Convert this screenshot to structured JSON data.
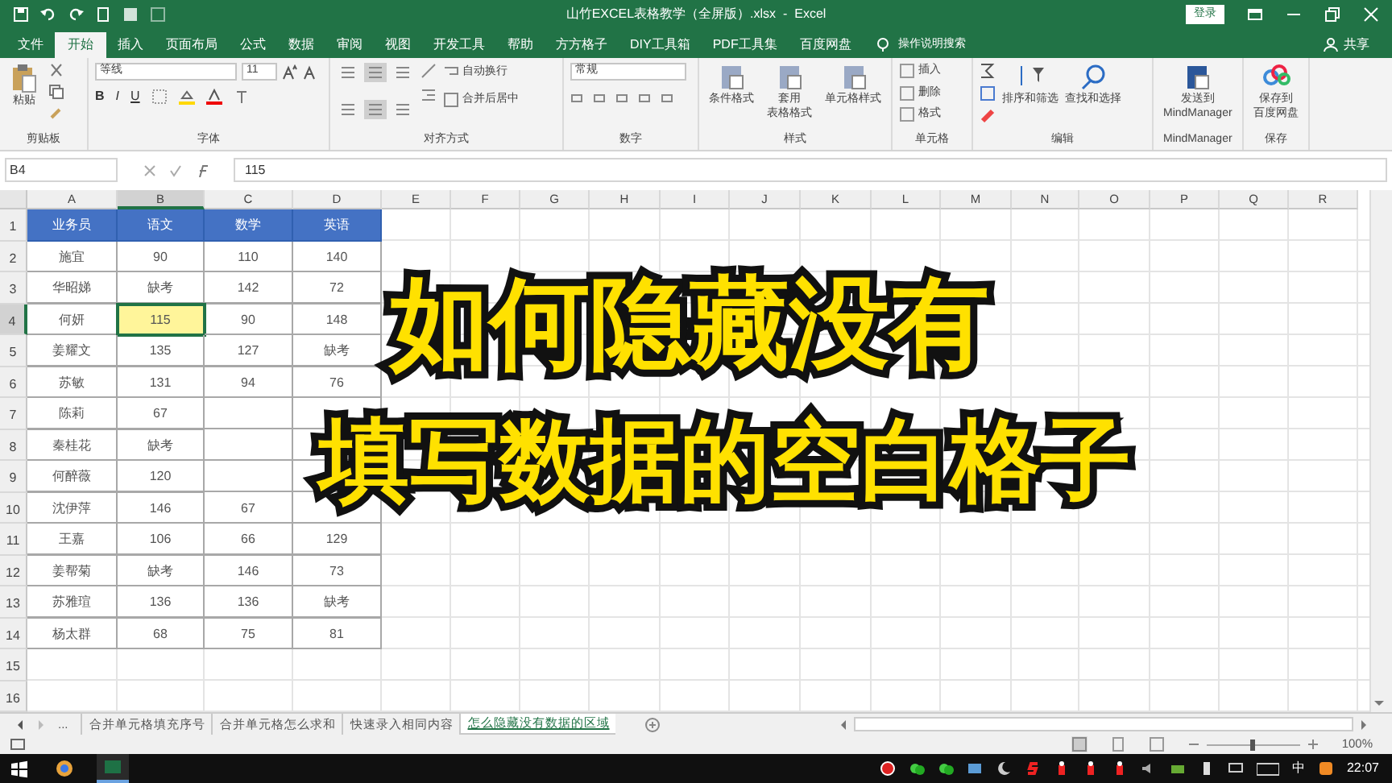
{
  "title_bar": {
    "title": "山竹EXCEL表格教学（全屏版）.xlsx  -  Excel",
    "login": "登录"
  },
  "menu_tabs": [
    {
      "label": "文件",
      "selected": false
    },
    {
      "label": "开始",
      "selected": true
    },
    {
      "label": "插入",
      "selected": false
    },
    {
      "label": "页面布局",
      "selected": false
    },
    {
      "label": "公式",
      "selected": false
    },
    {
      "label": "数据",
      "selected": false
    },
    {
      "label": "审阅",
      "selected": false
    },
    {
      "label": "视图",
      "selected": false
    },
    {
      "label": "开发工具",
      "selected": false
    },
    {
      "label": "帮助",
      "selected": false
    },
    {
      "label": "方方格子",
      "selected": false
    },
    {
      "label": "DIY工具箱",
      "selected": false
    },
    {
      "label": "PDF工具集",
      "selected": false
    },
    {
      "label": "百度网盘",
      "selected": false
    }
  ],
  "tell_me": "操作说明搜索",
  "share": "共享",
  "ribbon": {
    "groups": [
      {
        "kind": "clipboard",
        "label": "剪贴板",
        "buttons": [
          "粘贴"
        ]
      },
      {
        "kind": "font",
        "label": "字体",
        "font": "等线",
        "size": "11",
        "buttons": [
          "B",
          "I",
          "U"
        ]
      },
      {
        "kind": "alignment",
        "label": "对齐方式",
        "buttons": [
          "自动换行",
          "合并后居中"
        ]
      },
      {
        "kind": "number",
        "label": "数字",
        "format": "常规"
      },
      {
        "kind": "large",
        "label": "样式",
        "buttons": [
          [
            "条件格式"
          ],
          [
            "套用",
            "表格格式"
          ],
          [
            "单元格样式"
          ]
        ]
      },
      {
        "kind": "cells",
        "label": "单元格",
        "buttons": [
          "插入",
          "删除",
          "格式"
        ]
      },
      {
        "kind": "editing",
        "label": "编辑",
        "buttons": [
          "排序和筛选",
          "查找和选择"
        ]
      },
      {
        "kind": "large",
        "label": "MindManager",
        "buttons": [
          [
            "发送到",
            "MindManager"
          ]
        ]
      },
      {
        "kind": "large",
        "label": "保存",
        "buttons": [
          [
            "保存到",
            "百度网盘"
          ]
        ]
      }
    ]
  },
  "name_box": "B4",
  "formula": "115",
  "columns": [
    {
      "label": "A",
      "selected": false
    },
    {
      "label": "B",
      "selected": true
    },
    {
      "label": "C",
      "selected": false
    },
    {
      "label": "D",
      "selected": false
    },
    {
      "label": "E",
      "selected": false
    },
    {
      "label": "F",
      "selected": false
    },
    {
      "label": "G",
      "selected": false
    },
    {
      "label": "H",
      "selected": false
    },
    {
      "label": "I",
      "selected": false
    },
    {
      "label": "J",
      "selected": false
    },
    {
      "label": "K",
      "selected": false
    },
    {
      "label": "L",
      "selected": false
    },
    {
      "label": "M",
      "selected": false
    },
    {
      "label": "N",
      "selected": false
    },
    {
      "label": "O",
      "selected": false
    },
    {
      "label": "P",
      "selected": false
    },
    {
      "label": "Q",
      "selected": false
    },
    {
      "label": "R",
      "selected": false
    }
  ],
  "row_headers": [
    {
      "label": "1",
      "selected": false
    },
    {
      "label": "2",
      "selected": false
    },
    {
      "label": "3",
      "selected": false
    },
    {
      "label": "4",
      "selected": true
    },
    {
      "label": "5",
      "selected": false
    },
    {
      "label": "6",
      "selected": false
    },
    {
      "label": "7",
      "selected": false
    },
    {
      "label": "8",
      "selected": false
    },
    {
      "label": "9",
      "selected": false
    },
    {
      "label": "10",
      "selected": false
    },
    {
      "label": "11",
      "selected": false
    },
    {
      "label": "12",
      "selected": false
    },
    {
      "label": "13",
      "selected": false
    },
    {
      "label": "14",
      "selected": false
    },
    {
      "label": "15",
      "selected": false
    },
    {
      "label": "16",
      "selected": false
    }
  ],
  "table": {
    "header": [
      "业务员",
      "语文",
      "数学",
      "英语"
    ],
    "rows": [
      {
        "cells": [
          "施宜",
          "90",
          "110",
          "140"
        ]
      },
      {
        "cells": [
          "华昭娣",
          "缺考",
          "142",
          "72"
        ]
      },
      {
        "cells": [
          "何妍",
          "115",
          "90",
          "148"
        ]
      },
      {
        "cells": [
          "姜耀文",
          "135",
          "127",
          "缺考"
        ]
      },
      {
        "cells": [
          "苏敏",
          "131",
          "94",
          "76"
        ]
      },
      {
        "cells": [
          "陈莉",
          "67"
        ]
      },
      {
        "cells": [
          "秦桂花",
          "缺考"
        ]
      },
      {
        "cells": [
          "何醉薇",
          "120"
        ]
      },
      {
        "cells": [
          "沈伊萍",
          "146",
          "67"
        ]
      },
      {
        "cells": [
          "王嘉",
          "106",
          "66",
          "129"
        ]
      },
      {
        "cells": [
          "姜帮菊",
          "缺考",
          "146",
          "73"
        ]
      },
      {
        "cells": [
          "苏雅瑄",
          "136",
          "136",
          "缺考"
        ]
      },
      {
        "cells": [
          "杨太群",
          "68",
          "75",
          "81"
        ]
      }
    ]
  },
  "overlay_title": [
    "如何隐藏没有",
    "填写数据的空白格子"
  ],
  "sheet_tabs": {
    "more": "...",
    "tabs": [
      {
        "label": "合并单元格填充序号",
        "selected": false
      },
      {
        "label": "合并单元格怎么求和",
        "selected": false
      },
      {
        "label": "快速录入相同内容",
        "selected": false
      },
      {
        "label": "怎么隐藏没有数据的区域",
        "selected": true
      }
    ]
  },
  "status_bar": {
    "zoom": "100%",
    "zoom_slider": {
      "level": 0.5
    }
  },
  "taskbar": {
    "ime": "中",
    "clock": "22:07"
  }
}
